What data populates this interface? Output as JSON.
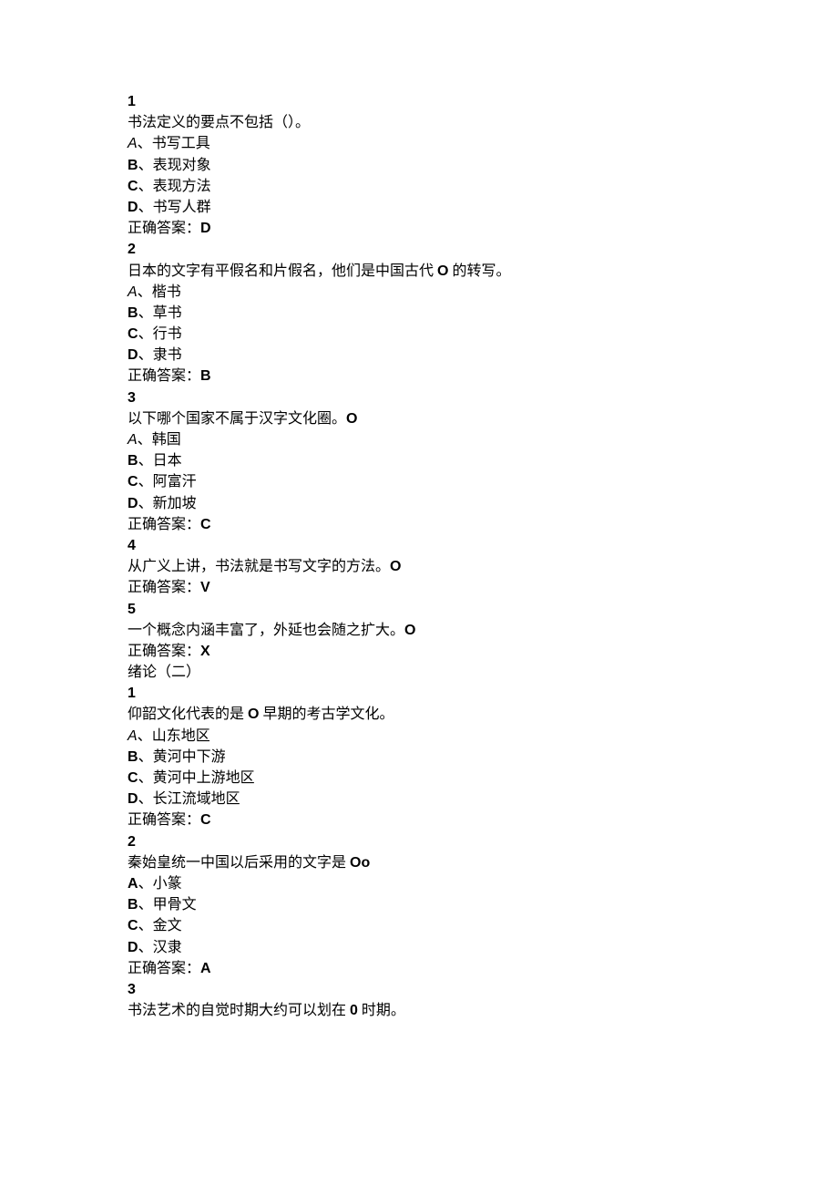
{
  "s1": {
    "num": "1",
    "stem": "书法定义的要点不包括（）。",
    "opts": [
      {
        "letter": "A",
        "sep": "、",
        "text": "书写工具",
        "italicLetter": true
      },
      {
        "letter": "B",
        "sep": "、",
        "text": "表现对象"
      },
      {
        "letter": "C",
        "sep": "、",
        "text": "表现方法"
      },
      {
        "letter": "D",
        "sep": "、",
        "text": "书写人群"
      }
    ],
    "ansLabel": "正确答案：",
    "ans": "D"
  },
  "s2": {
    "num": "2",
    "stemPre": "日本的文字有平假名和片假名，他们是中国古代 ",
    "stemBold": "O",
    "stemPost": " 的转写。",
    "opts": [
      {
        "letter": "A",
        "sep": "、",
        "text": "楷书",
        "italicLetter": true
      },
      {
        "letter": "B",
        "sep": "、",
        "text": "草书"
      },
      {
        "letter": "C",
        "sep": "、",
        "text": "行书"
      },
      {
        "letter": "D",
        "sep": "、",
        "text": "隶书"
      }
    ],
    "ansLabel": "正确答案：",
    "ans": "B"
  },
  "s3": {
    "num": "3",
    "stemPre": "以下哪个国家不属于汉字文化圈。",
    "stemBold": "O",
    "opts": [
      {
        "letter": "A",
        "sep": "、",
        "text": "韩国",
        "italicLetter": true
      },
      {
        "letter": "B",
        "sep": "、",
        "text": "日本"
      },
      {
        "letter": "C",
        "sep": "、",
        "text": "阿富汗"
      },
      {
        "letter": "D",
        "sep": "、",
        "text": "新加坡"
      }
    ],
    "ansLabel": "正确答案：",
    "ans": "C"
  },
  "s4": {
    "num": "4",
    "stemPre": "从广义上讲，书法就是书写文字的方法。",
    "stemBold": "O",
    "ansLabel": "正确答案：",
    "ans": "V"
  },
  "s5": {
    "num": "5",
    "stemPre": "一个概念内涵丰富了，外延也会随之扩大。",
    "stemBold": "O",
    "ansLabel": "正确答案：",
    "ans": "X"
  },
  "sectionHeader": "绪论（二）",
  "s6": {
    "num": "1",
    "stemPre": "仰韶文化代表的是 ",
    "stemBold": "O",
    "stemPost": " 早期的考古学文化。",
    "opts": [
      {
        "letter": "A",
        "sep": "、",
        "text": "山东地区",
        "italicLetter": true
      },
      {
        "letter": "B",
        "sep": "、",
        "text": "黄河中下游"
      },
      {
        "letter": "C",
        "sep": "、",
        "text": "黄河中上游地区"
      },
      {
        "letter": "D",
        "sep": "、",
        "text": "长江流域地区"
      }
    ],
    "ansLabel": "正确答案：",
    "ans": "C"
  },
  "s7": {
    "num": "2",
    "stemPre": "秦始皇统一中国以后采用的文字是 ",
    "stemBold": "Oo",
    "opts": [
      {
        "letter": "A",
        "sep": "、",
        "text": "小篆"
      },
      {
        "letter": "B",
        "sep": "、",
        "text": "甲骨文"
      },
      {
        "letter": "C",
        "sep": "、",
        "text": "金文"
      },
      {
        "letter": "D",
        "sep": "、",
        "text": "汉隶"
      }
    ],
    "ansLabel": "正确答案：",
    "ans": "A"
  },
  "s8": {
    "num": "3",
    "stemPre": "书法艺术的自觉时期大约可以划在 ",
    "stemBold": "0",
    "stemPost": " 时期。"
  }
}
